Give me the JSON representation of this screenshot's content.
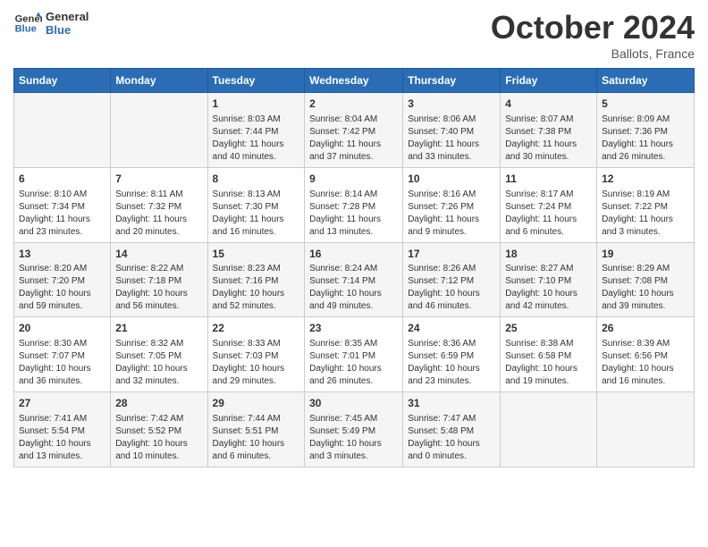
{
  "header": {
    "logo_line1": "General",
    "logo_line2": "Blue",
    "month": "October 2024",
    "location": "Ballots, France"
  },
  "days_of_week": [
    "Sunday",
    "Monday",
    "Tuesday",
    "Wednesday",
    "Thursday",
    "Friday",
    "Saturday"
  ],
  "weeks": [
    [
      {
        "day": "",
        "info": ""
      },
      {
        "day": "",
        "info": ""
      },
      {
        "day": "1",
        "info": "Sunrise: 8:03 AM\nSunset: 7:44 PM\nDaylight: 11 hours and 40 minutes."
      },
      {
        "day": "2",
        "info": "Sunrise: 8:04 AM\nSunset: 7:42 PM\nDaylight: 11 hours and 37 minutes."
      },
      {
        "day": "3",
        "info": "Sunrise: 8:06 AM\nSunset: 7:40 PM\nDaylight: 11 hours and 33 minutes."
      },
      {
        "day": "4",
        "info": "Sunrise: 8:07 AM\nSunset: 7:38 PM\nDaylight: 11 hours and 30 minutes."
      },
      {
        "day": "5",
        "info": "Sunrise: 8:09 AM\nSunset: 7:36 PM\nDaylight: 11 hours and 26 minutes."
      }
    ],
    [
      {
        "day": "6",
        "info": "Sunrise: 8:10 AM\nSunset: 7:34 PM\nDaylight: 11 hours and 23 minutes."
      },
      {
        "day": "7",
        "info": "Sunrise: 8:11 AM\nSunset: 7:32 PM\nDaylight: 11 hours and 20 minutes."
      },
      {
        "day": "8",
        "info": "Sunrise: 8:13 AM\nSunset: 7:30 PM\nDaylight: 11 hours and 16 minutes."
      },
      {
        "day": "9",
        "info": "Sunrise: 8:14 AM\nSunset: 7:28 PM\nDaylight: 11 hours and 13 minutes."
      },
      {
        "day": "10",
        "info": "Sunrise: 8:16 AM\nSunset: 7:26 PM\nDaylight: 11 hours and 9 minutes."
      },
      {
        "day": "11",
        "info": "Sunrise: 8:17 AM\nSunset: 7:24 PM\nDaylight: 11 hours and 6 minutes."
      },
      {
        "day": "12",
        "info": "Sunrise: 8:19 AM\nSunset: 7:22 PM\nDaylight: 11 hours and 3 minutes."
      }
    ],
    [
      {
        "day": "13",
        "info": "Sunrise: 8:20 AM\nSunset: 7:20 PM\nDaylight: 10 hours and 59 minutes."
      },
      {
        "day": "14",
        "info": "Sunrise: 8:22 AM\nSunset: 7:18 PM\nDaylight: 10 hours and 56 minutes."
      },
      {
        "day": "15",
        "info": "Sunrise: 8:23 AM\nSunset: 7:16 PM\nDaylight: 10 hours and 52 minutes."
      },
      {
        "day": "16",
        "info": "Sunrise: 8:24 AM\nSunset: 7:14 PM\nDaylight: 10 hours and 49 minutes."
      },
      {
        "day": "17",
        "info": "Sunrise: 8:26 AM\nSunset: 7:12 PM\nDaylight: 10 hours and 46 minutes."
      },
      {
        "day": "18",
        "info": "Sunrise: 8:27 AM\nSunset: 7:10 PM\nDaylight: 10 hours and 42 minutes."
      },
      {
        "day": "19",
        "info": "Sunrise: 8:29 AM\nSunset: 7:08 PM\nDaylight: 10 hours and 39 minutes."
      }
    ],
    [
      {
        "day": "20",
        "info": "Sunrise: 8:30 AM\nSunset: 7:07 PM\nDaylight: 10 hours and 36 minutes."
      },
      {
        "day": "21",
        "info": "Sunrise: 8:32 AM\nSunset: 7:05 PM\nDaylight: 10 hours and 32 minutes."
      },
      {
        "day": "22",
        "info": "Sunrise: 8:33 AM\nSunset: 7:03 PM\nDaylight: 10 hours and 29 minutes."
      },
      {
        "day": "23",
        "info": "Sunrise: 8:35 AM\nSunset: 7:01 PM\nDaylight: 10 hours and 26 minutes."
      },
      {
        "day": "24",
        "info": "Sunrise: 8:36 AM\nSunset: 6:59 PM\nDaylight: 10 hours and 23 minutes."
      },
      {
        "day": "25",
        "info": "Sunrise: 8:38 AM\nSunset: 6:58 PM\nDaylight: 10 hours and 19 minutes."
      },
      {
        "day": "26",
        "info": "Sunrise: 8:39 AM\nSunset: 6:56 PM\nDaylight: 10 hours and 16 minutes."
      }
    ],
    [
      {
        "day": "27",
        "info": "Sunrise: 7:41 AM\nSunset: 5:54 PM\nDaylight: 10 hours and 13 minutes."
      },
      {
        "day": "28",
        "info": "Sunrise: 7:42 AM\nSunset: 5:52 PM\nDaylight: 10 hours and 10 minutes."
      },
      {
        "day": "29",
        "info": "Sunrise: 7:44 AM\nSunset: 5:51 PM\nDaylight: 10 hours and 6 minutes."
      },
      {
        "day": "30",
        "info": "Sunrise: 7:45 AM\nSunset: 5:49 PM\nDaylight: 10 hours and 3 minutes."
      },
      {
        "day": "31",
        "info": "Sunrise: 7:47 AM\nSunset: 5:48 PM\nDaylight: 10 hours and 0 minutes."
      },
      {
        "day": "",
        "info": ""
      },
      {
        "day": "",
        "info": ""
      }
    ]
  ]
}
